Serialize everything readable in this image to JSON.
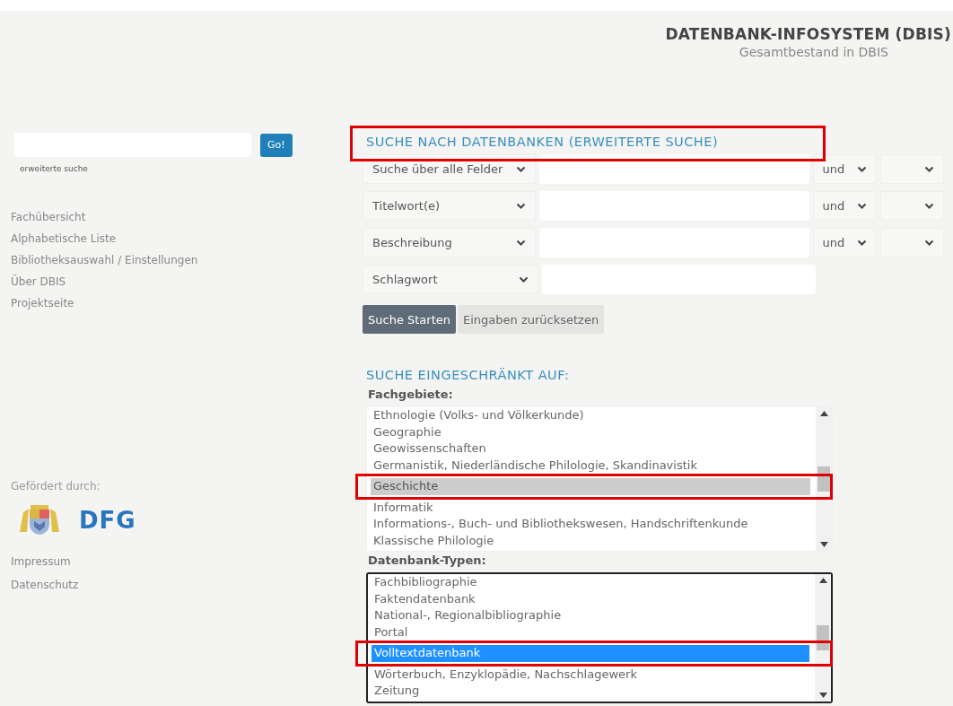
{
  "header": {
    "title": "DATENBANK-INFOSYSTEM (DBIS)",
    "subtitle": "Gesamtbestand in DBIS"
  },
  "sidebar": {
    "search": {
      "button": "Go!"
    },
    "advanced_link": "erweiterte suche",
    "nav": [
      "Fachübersicht",
      "Alphabetische Liste",
      "Bibliotheksauswahl / Einstellungen",
      "Über DBIS",
      "Projektseite"
    ],
    "funding_label": "Gefördert durch:",
    "logo_text": "DFG",
    "footer_links": [
      "Impressum",
      "Datenschutz"
    ]
  },
  "search": {
    "heading": "SUCHE NACH DATENBANKEN (ERWEITERTE SUCHE)",
    "heading_annotated": true,
    "rows": [
      {
        "field": "Suche über alle Felder",
        "operator": "und"
      },
      {
        "field": "Titelwort(e)",
        "operator": "und"
      },
      {
        "field": "Beschreibung",
        "operator": "und"
      },
      {
        "field": "Schlagwort"
      }
    ],
    "buttons": [
      {
        "label": "Suche Starten",
        "kind": "primary"
      },
      {
        "label": "Eingaben zurücksetzen",
        "kind": "secondary"
      }
    ]
  },
  "restrict": {
    "heading": "SUCHE EINGESCHRÄNKT AUF:",
    "lists": [
      {
        "label": "Fachgebiete:",
        "focused": false,
        "items": [
          {
            "text": "Ethnologie (Volks- und Völkerkunde)",
            "selected": false,
            "annotated": false
          },
          {
            "text": "Geographie",
            "selected": false,
            "annotated": false
          },
          {
            "text": "Geowissenschaften",
            "selected": false,
            "annotated": false
          },
          {
            "text": "Germanistik, Niederländische Philologie, Skandinavistik",
            "selected": false,
            "annotated": false
          },
          {
            "text": "Geschichte",
            "selected": true,
            "annotated": true
          },
          {
            "text": "Informatik",
            "selected": false,
            "annotated": false
          },
          {
            "text": "Informations-, Buch- und Bibliothekswesen, Handschriftenkunde",
            "selected": false,
            "annotated": false
          },
          {
            "text": "Klassische Philologie",
            "selected": false,
            "annotated": false
          }
        ]
      },
      {
        "label": "Datenbank-Typen:",
        "focused": true,
        "items": [
          {
            "text": "Fachbibliographie",
            "selected": false,
            "annotated": false
          },
          {
            "text": "Faktendatenbank",
            "selected": false,
            "annotated": false
          },
          {
            "text": "National-, Regionalbibliographie",
            "selected": false,
            "annotated": false
          },
          {
            "text": "Portal",
            "selected": false,
            "annotated": false
          },
          {
            "text": "Volltextdatenbank",
            "selected": true,
            "annotated": true
          },
          {
            "text": "Wörterbuch, Enzyklopädie, Nachschlagewerk",
            "selected": false,
            "annotated": false
          },
          {
            "text": "Zeitung",
            "selected": false,
            "annotated": false
          }
        ]
      }
    ]
  }
}
